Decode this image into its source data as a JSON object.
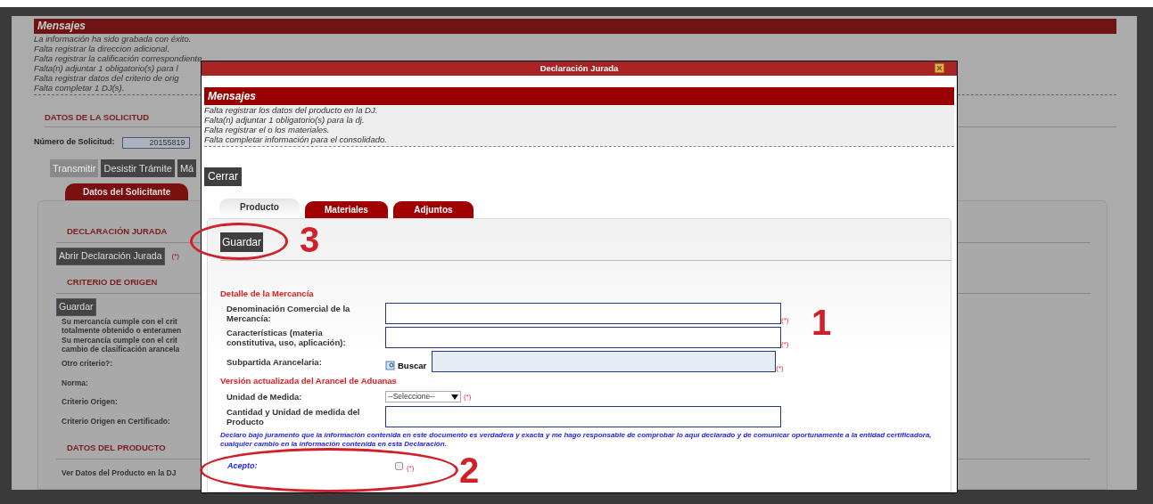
{
  "background_page": {
    "messages_title": "Mensajes",
    "messages": [
      "La información ha sido grabada con éxito.",
      "Falta registrar la direccion adicional.",
      "Falta registrar la calificación correspondiente",
      "Falta(n) adjuntar 1 obligatorio(s) para l",
      "Falta registrar datos del criterio de orig",
      "Falta completar 1 DJ(s)."
    ],
    "solicitud": {
      "title": "DATOS DE LA SOLICITUD",
      "number_label": "Número de Solicitud:",
      "number_value": "20155819"
    },
    "buttons": [
      {
        "label": "Transmitir",
        "disabled": true
      },
      {
        "label": "Desistir Trámite",
        "disabled": false
      },
      {
        "label": "Má",
        "disabled": false
      }
    ],
    "tabs": [
      {
        "label": "Datos del Solicitante",
        "selected": true
      }
    ],
    "panel_items": [
      {
        "kind": "heading",
        "text": "DECLARACIÓN JURADA"
      },
      {
        "kind": "button",
        "text": "Abrir Declaración Jurada",
        "required": "(*)"
      },
      {
        "kind": "heading",
        "text": "CRITERIO DE ORIGEN"
      },
      {
        "kind": "button",
        "text": "Guardar"
      },
      {
        "kind": "text",
        "text": "Su mercancía cumple con el crit\ntotalmente obtenido o enteramen"
      },
      {
        "kind": "text",
        "text": "Su mercancía cumple con el crit\ncambio de clasificación arancela"
      },
      {
        "kind": "label",
        "text": "Otro criterio?:"
      },
      {
        "kind": "label",
        "text": "Norma:"
      },
      {
        "kind": "label",
        "text": "Criterio Origen:"
      },
      {
        "kind": "label",
        "text": "Criterio Origen en Certificado:"
      },
      {
        "kind": "heading",
        "text": "DATOS DEL PRODUCTO"
      },
      {
        "kind": "label",
        "text": "Ver Datos del Producto en la DJ"
      }
    ]
  },
  "dialog": {
    "title": "Declaración Jurada",
    "messages_title": "Mensajes",
    "messages": [
      "Falta registrar los datos del producto en la DJ.",
      "Falta(n) adjuntar 1 obligatorio(s) para la dj.",
      "Falta registrar el o los materiales.",
      "Falta completar información para el consolidado."
    ],
    "close_button": "Cerrar",
    "tabs": [
      {
        "label": "Producto",
        "selected": true
      },
      {
        "label": "Materiales",
        "selected": false
      },
      {
        "label": "Adjuntos",
        "selected": false
      }
    ],
    "save_button": "Guardar",
    "form_items": [
      {
        "kind": "heading",
        "text": "Detalle de la Mercancía"
      },
      {
        "kind": "textarea",
        "label": "Denominación Comercial de la Mercancía:",
        "required": "(*)"
      },
      {
        "kind": "textarea",
        "label": "Características (materia constitutiva, uso, aplicación):",
        "required": "(*)"
      },
      {
        "kind": "search",
        "label": "Subpartida Arancelaria:",
        "button": "Buscar",
        "required": "(*)"
      },
      {
        "kind": "heading",
        "text": "Versión actualizada del Arancel de Aduanas"
      },
      {
        "kind": "select",
        "label": "Unidad de Medida:",
        "value": "--Seleccione--",
        "required": "(*)"
      },
      {
        "kind": "textarea",
        "label": "Cantidad y Unidad de medida del Producto"
      }
    ],
    "declaration": "Declaro bajo juramento que la información contenida en este documento es verdadera y exacta y me hago responsable de comprobar lo aquí declarado y de comunicar oportunamente a la entidad certificadora, cualquier cambio en la información contenida en esta Declaración.",
    "accept": {
      "label": "Acepto:",
      "checked": false,
      "required": "(*)"
    }
  },
  "annotations": [
    {
      "text": "1"
    },
    {
      "text": "2"
    },
    {
      "text": "3"
    }
  ]
}
